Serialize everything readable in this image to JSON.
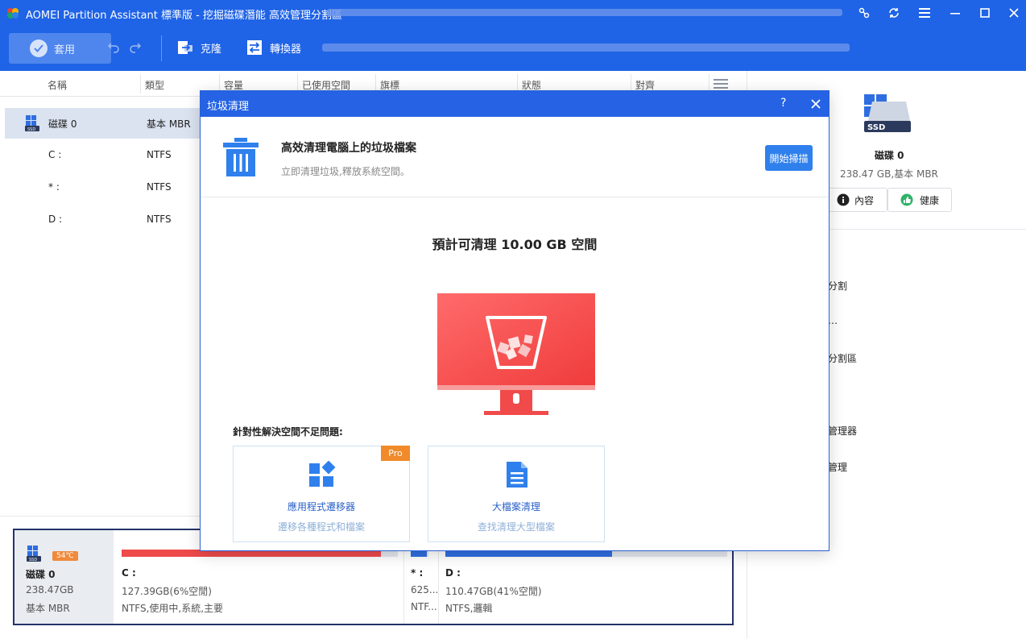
{
  "app": {
    "title": "AOMEI Partition Assistant 標準版 - 挖掘磁碟潛能 高效管理分割區",
    "window_controls": [
      "share-icon",
      "refresh-icon",
      "menu-icon",
      "minimize-icon",
      "maximize-icon",
      "close-icon"
    ]
  },
  "toolbar": {
    "apply_label": "套用",
    "clone_label": "克隆",
    "convert_label": "轉換器"
  },
  "columns": [
    "名稱",
    "類型",
    "容量",
    "已使用空間",
    "旗標",
    "狀態",
    "對齊"
  ],
  "disk_list": [
    {
      "name": "磁碟 0",
      "type": "基本 MBR",
      "selected": true,
      "is_disk": true
    },
    {
      "name": "C :",
      "type": "NTFS",
      "selected": false,
      "is_disk": false
    },
    {
      "name": "* :",
      "type": "NTFS",
      "selected": false,
      "is_disk": false
    },
    {
      "name": "D :",
      "type": "NTFS",
      "selected": false,
      "is_disk": false
    }
  ],
  "right_panel": {
    "disk_name": "磁碟 0",
    "disk_info": "238.47 GB,基本 MBR",
    "properties_label": "內容",
    "health_label": "健康",
    "operations": [
      "分割",
      "…",
      "分割區",
      "管理器",
      "管理"
    ]
  },
  "disk_map": {
    "disk_name": "磁碟 0",
    "disk_size": "238.47GB",
    "disk_type": "基本 MBR",
    "temperature": "54℃",
    "partitions": [
      {
        "label": "C :",
        "line1": "127.39GB(6%空閒)",
        "line2": "NTFS,使用中,系統,主要",
        "used_fraction": 0.94,
        "color": "#ee4a4a"
      },
      {
        "label": "* :",
        "line1": "625...",
        "line2": "NTF...",
        "used_fraction": 0.9,
        "color": "#2f6ee0"
      },
      {
        "label": "D :",
        "line1": "110.47GB(41%空閒)",
        "line2": "NTFS,邏輯",
        "used_fraction": 0.59,
        "color": "#2f6ee0"
      }
    ]
  },
  "dialog": {
    "title": "垃圾清理",
    "help_label": "?",
    "heading": "高效清理電腦上的垃圾檔案",
    "subheading": "立即清理垃圾,釋放系統空間。",
    "scan_button": "開始掃描",
    "estimate": "預計可清理 10.00 GB 空間",
    "section_label": "針對性解決空間不足問題:",
    "cards": [
      {
        "title": "應用程式遷移器",
        "subtitle": "遷移各種程式和檔案",
        "badge": "Pro",
        "icon": "apps-icon"
      },
      {
        "title": "大檔案清理",
        "subtitle": "查找清理大型檔案",
        "icon": "document-icon"
      }
    ]
  },
  "colors": {
    "brand_blue": "#1f63e6",
    "dialog_blue": "#2563e4",
    "accent_red": "#ee4a4a",
    "pro_orange": "#f08a2a"
  }
}
